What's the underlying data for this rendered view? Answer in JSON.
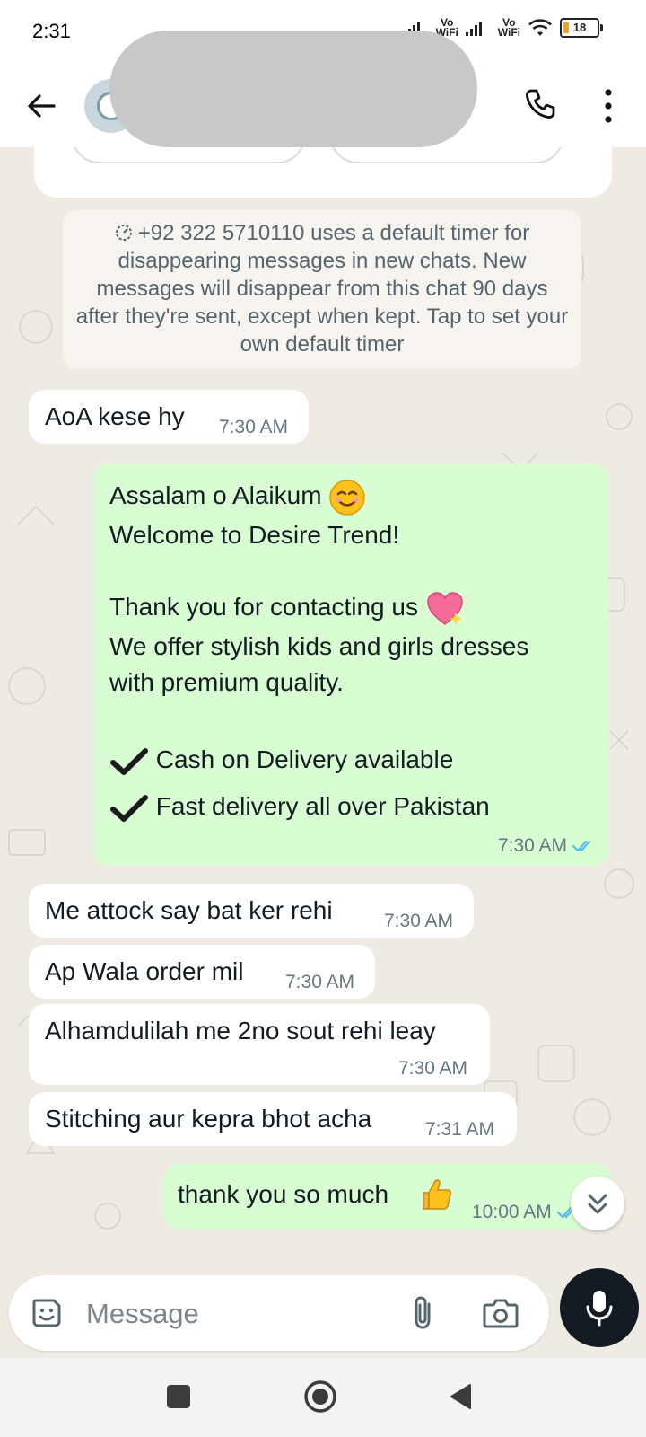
{
  "status_bar": {
    "time": "2:31",
    "sim1_label_top": "Vo",
    "sim1_label_bottom": "WiFi",
    "sim2_label_top": "Vo",
    "sim2_label_bottom": "WiFi",
    "battery": "18"
  },
  "header": {
    "back_icon": "arrow-left-icon",
    "call_icon": "phone-icon",
    "menu_icon": "more-vertical-icon"
  },
  "system_notice": {
    "text": "+92 322 5710110 uses a default timer for disappearing messages in new chats. New messages will disappear from this chat 90 days after they're sent, except when kept. Tap to set your own default timer"
  },
  "messages": [
    {
      "direction": "in",
      "text": "AoA kese hy",
      "time": "7:30 AM"
    },
    {
      "direction": "out",
      "lines": [
        "Assalam o Alaikum",
        "Welcome to Desire Trend!",
        "",
        "Thank you for contacting us",
        "We offer stylish kids and girls dresses",
        "with premium quality.",
        "",
        "Cash on Delivery available",
        "Fast delivery all over Pakistan"
      ],
      "time": "7:30 AM"
    },
    {
      "direction": "in",
      "text": "Me attock say bat ker rehi",
      "time": "7:30 AM"
    },
    {
      "direction": "in",
      "text": "Ap Wala order mil",
      "time": "7:30 AM"
    },
    {
      "direction": "in",
      "text": "Alhamdulilah me 2no sout rehi leay",
      "time": "7:30 AM"
    },
    {
      "direction": "in",
      "text": "Stitching aur kepra bhot acha",
      "time": "7:31 AM"
    },
    {
      "direction": "out",
      "text": "thank you so much",
      "time": "10:00 AM"
    }
  ],
  "composer": {
    "placeholder": "Message",
    "sticker_icon": "sticker-icon",
    "attach_icon": "paperclip-icon",
    "camera_icon": "camera-icon",
    "mic_icon": "microphone-icon"
  },
  "colors": {
    "outgoing_bubble": "#d9fdd3",
    "incoming_bubble": "#ffffff",
    "chat_background": "#efeae2",
    "read_ticks": "#53bdeb"
  }
}
